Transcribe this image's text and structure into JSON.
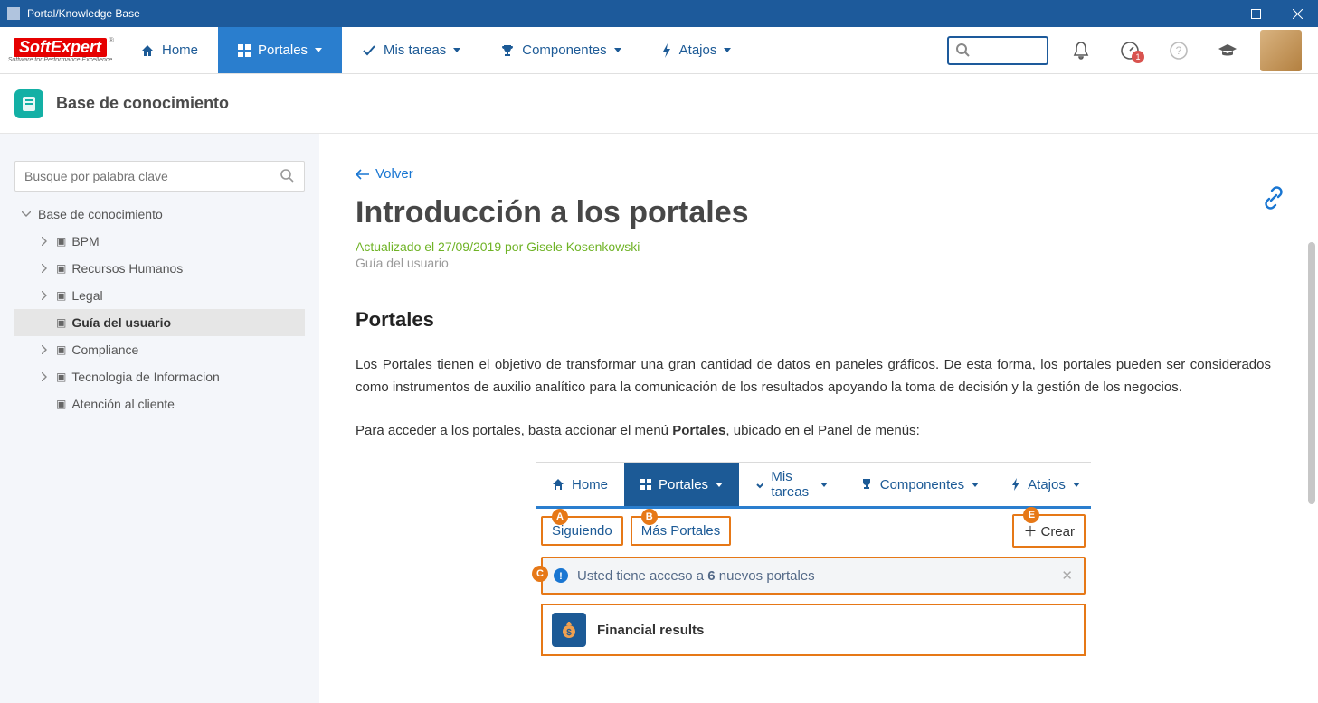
{
  "window": {
    "title": "Portal/Knowledge Base"
  },
  "logo": {
    "main": "SoftExpert",
    "sub": "Software for Performance Excellence"
  },
  "topnav": {
    "items": [
      {
        "label": "Home",
        "icon": "home-icon"
      },
      {
        "label": "Portales",
        "icon": "grid-icon",
        "caret": true,
        "active": true
      },
      {
        "label": "Mis tareas",
        "icon": "check-icon",
        "caret": true
      },
      {
        "label": "Componentes",
        "icon": "trophy-icon",
        "caret": true
      },
      {
        "label": "Atajos",
        "icon": "bolt-icon",
        "caret": true
      }
    ],
    "search_placeholder": "",
    "notification_badge": "1"
  },
  "page": {
    "header_title": "Base de conocimiento"
  },
  "sidebar": {
    "search_placeholder": "Busque por palabra clave",
    "root_label": "Base de conocimiento",
    "items": [
      {
        "label": "BPM",
        "expandable": true
      },
      {
        "label": "Recursos Humanos",
        "expandable": true
      },
      {
        "label": "Legal",
        "expandable": true
      },
      {
        "label": "Guía del usuario",
        "expandable": false,
        "selected": true
      },
      {
        "label": "Compliance",
        "expandable": true
      },
      {
        "label": "Tecnologia de Informacion",
        "expandable": true
      },
      {
        "label": "Atención al cliente",
        "expandable": false
      }
    ]
  },
  "article": {
    "back_label": "Volver",
    "title": "Introducción a los portales",
    "updated": "Actualizado el 27/09/2019 por Gisele Kosenkowski",
    "category": "Guía del usuario",
    "section_heading": "Portales",
    "p1": "Los Portales tienen el objetivo de transformar una gran cantidad de datos en paneles gráficos. De esta forma, los portales pueden ser considerados como instrumentos de auxilio analítico para la comunicación de los resultados apoyando la toma de decisión y la gestión de los negocios.",
    "p2_pre": "Para acceder a los portales, basta accionar el menú ",
    "p2_bold": "Portales",
    "p2_mid": ", ubicado en el ",
    "p2_underline": "Panel de menús",
    "p2_post": ":"
  },
  "embedded": {
    "nav": {
      "home": "Home",
      "portales": "Portales",
      "mis_tareas": "Mis tareas",
      "componentes": "Componentes",
      "atajos": "Atajos"
    },
    "tabs": {
      "a_label": "Siguiendo",
      "b_label": "Más Portales",
      "e_label": "Crear"
    },
    "notice_pre": "Usted tiene acceso a ",
    "notice_bold": "6",
    "notice_post": " nuevos portales",
    "item_label": "Financial results",
    "callouts": {
      "a": "A",
      "b": "B",
      "c": "C",
      "e": "E"
    }
  }
}
